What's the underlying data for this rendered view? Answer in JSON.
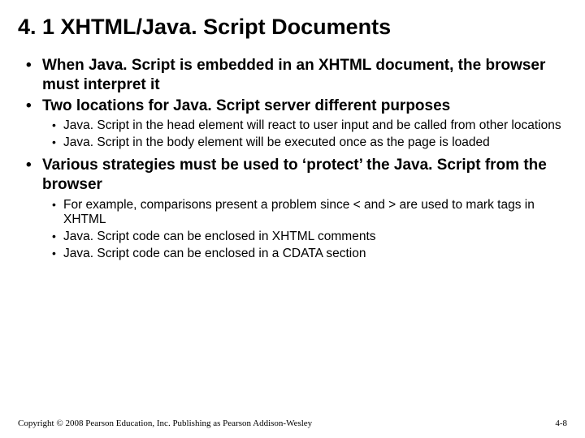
{
  "title": "4. 1 XHTML/Java. Script Documents",
  "bullets": {
    "b1": "When Java. Script is embedded in an XHTML document, the browser must interpret it",
    "b2": "Two locations for Java. Script server different purposes",
    "b2_sub": {
      "s1": "Java. Script in the head element will react to user input and be called from other locations",
      "s2": "Java. Script in the body element will be executed once as the page is loaded"
    },
    "b3": "Various strategies must be used to ‘protect’ the Java. Script from the browser",
    "b3_sub": {
      "s1": "For example, comparisons present a problem since < and > are used to mark tags in XHTML",
      "s2": "Java. Script code can be enclosed in XHTML comments",
      "s3": "Java. Script code can be enclosed in a CDATA section"
    }
  },
  "footer": {
    "copyright": "Copyright © 2008 Pearson Education, Inc. Publishing as Pearson Addison-Wesley",
    "pagenum": "4-8"
  }
}
